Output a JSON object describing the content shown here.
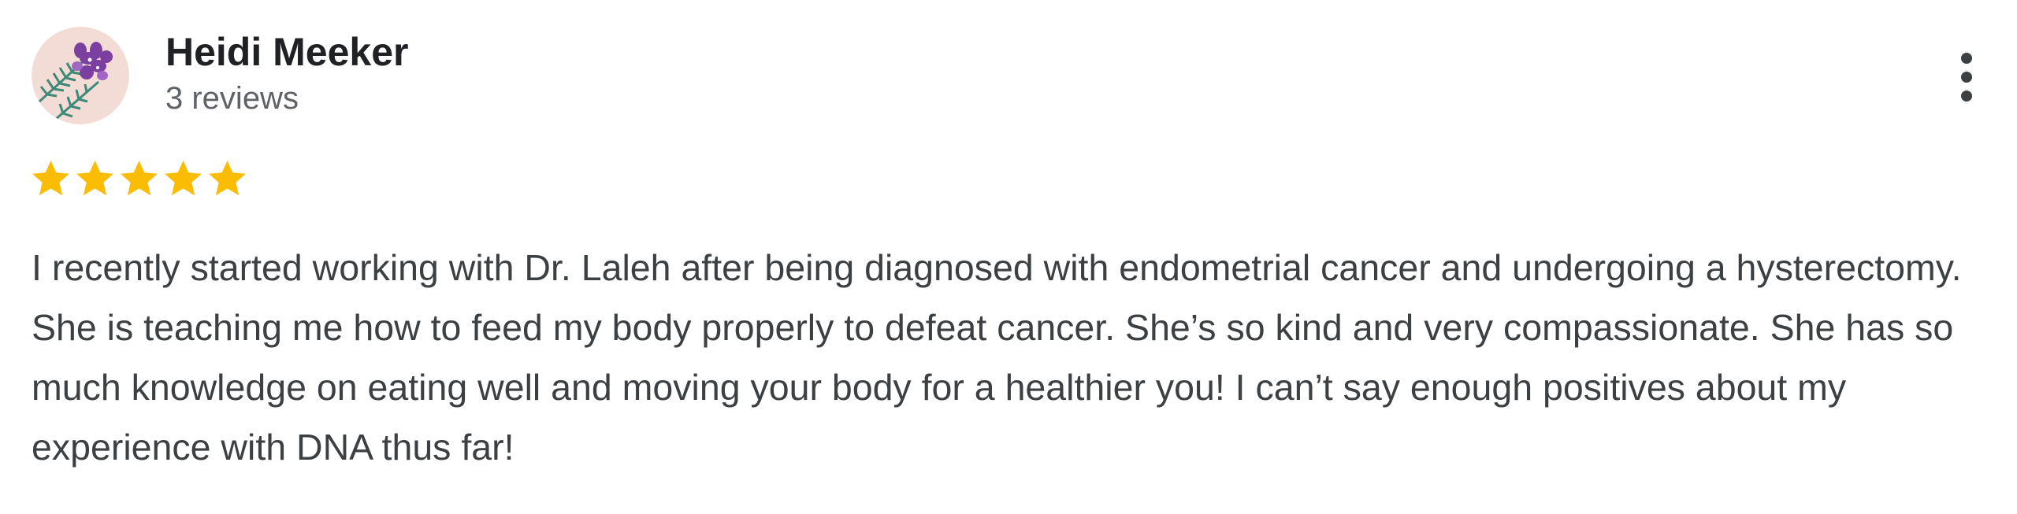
{
  "review": {
    "author_name": "Heidi Meeker",
    "review_count": "3 reviews",
    "avatar_icon": "flower-avatar",
    "rating": 5,
    "rating_max": 5,
    "star_color": "#fbbc04",
    "text": "I recently started working with Dr. Laleh after being diagnosed with endometrial cancer and undergoing a hysterectomy. She is teaching me how to feed my body properly to defeat cancer. She’s so kind and very compassionate. She has so much knowledge on eating well and moving your body for a healthier you! I can’t say enough positives about my experience with DNA thus far!",
    "more_options_icon": "more-vertical-icon"
  }
}
